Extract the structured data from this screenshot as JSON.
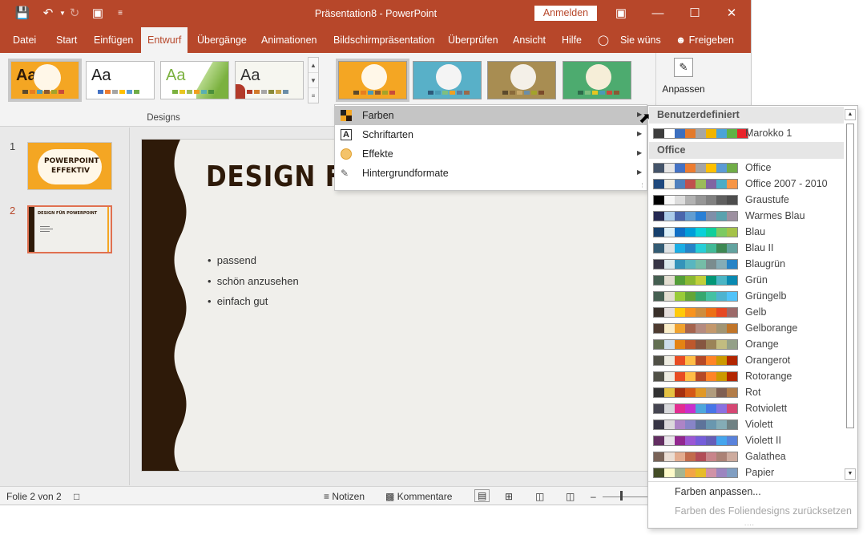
{
  "titlebar": {
    "title": "Präsentation8  -  PowerPoint",
    "signin": "Anmelden"
  },
  "tabs": [
    "Datei",
    "Start",
    "Einfügen",
    "Entwurf",
    "Übergänge",
    "Animationen",
    "Bildschirmpräsentation",
    "Überprüfen",
    "Ansicht",
    "Hilfe",
    "Sie wüns",
    "Freigeben"
  ],
  "ribbon": {
    "designs_label": "Designs",
    "themes": [
      {
        "label": "Aa",
        "bg": "#f4a623",
        "fg": "#2e1a09"
      },
      {
        "label": "Aa",
        "bg": "#ffffff",
        "fg": "#222222"
      },
      {
        "label": "Aa",
        "bg": "#ffffff",
        "fg": "#7bb13f"
      },
      {
        "label": "Aa",
        "bg": "#f6f6f0",
        "fg": "#333333"
      }
    ],
    "variants": [
      {
        "bg": "#f4a623",
        "circle": "#fff7e8"
      },
      {
        "bg": "#58b0c8",
        "circle": "#f4f4f4"
      },
      {
        "bg": "#a88d52",
        "circle": "#f4f0e8"
      },
      {
        "bg": "#4dab6f",
        "circle": "#f6eed8"
      }
    ],
    "customize_label": "Anpassen"
  },
  "slides_panel": {
    "slide1_num": "1",
    "slide1_text": "POWERPOINT EFFEKTIV",
    "slide2_num": "2",
    "slide2_title": "DESIGN FÜR POWERPOINT"
  },
  "slide": {
    "title": "DESIGN FÜ",
    "bullets": [
      "passend",
      "schön anzusehen",
      "einfach gut"
    ]
  },
  "statusbar": {
    "slide_info": "Folie 2 von 2",
    "notes": "Notizen",
    "comments": "Kommentare"
  },
  "menu": {
    "items": [
      {
        "label": "Farben",
        "icon": "colors-icon"
      },
      {
        "label": "Schriftarten",
        "icon": "fonts-icon"
      },
      {
        "label": "Effekte",
        "icon": "effects-icon"
      },
      {
        "label": "Hintergrundformate",
        "icon": "background-icon"
      }
    ]
  },
  "colors": {
    "custom_header": "Benutzerdefiniert",
    "office_header": "Office",
    "custom_link": "Farben anpassen...",
    "reset_link": "Farben des Foliendesigns zurücksetzen",
    "custom": [
      {
        "name": "Marokko 1",
        "swatches": [
          "#3d3d3d",
          "#ffffff",
          "#3c6fbf",
          "#e37a2c",
          "#a6a6a6",
          "#f0b400",
          "#4aa3d8",
          "#5fb246",
          "#e8242b"
        ]
      }
    ],
    "office": [
      {
        "name": "Office",
        "swatches": [
          "#44546a",
          "#e7e6e6",
          "#4472c4",
          "#ed7d31",
          "#a5a5a5",
          "#ffc000",
          "#5b9bd5",
          "#70ad47"
        ]
      },
      {
        "name": "Office 2007 - 2010",
        "swatches": [
          "#1f497d",
          "#eeece1",
          "#4f81bd",
          "#c0504d",
          "#9bbb59",
          "#8064a2",
          "#4bacc6",
          "#f79646"
        ]
      },
      {
        "name": "Graustufe",
        "swatches": [
          "#000000",
          "#f8f8f8",
          "#dddddd",
          "#b2b2b2",
          "#969696",
          "#808080",
          "#5f5f5f",
          "#4d4d4d"
        ]
      },
      {
        "name": "Warmes Blau",
        "swatches": [
          "#242852",
          "#acccea",
          "#4a66ac",
          "#629dd1",
          "#297fd5",
          "#7f8fa9",
          "#5aa2ae",
          "#9d90a0"
        ]
      },
      {
        "name": "Blau",
        "swatches": [
          "#17406d",
          "#dbeff9",
          "#0f6fc6",
          "#009dd9",
          "#0bd0d9",
          "#10cf9b",
          "#7cca62",
          "#a5c249"
        ]
      },
      {
        "name": "Blau II",
        "swatches": [
          "#335b74",
          "#dfe3e5",
          "#1cade4",
          "#2683c6",
          "#27ced7",
          "#42ba97",
          "#3e8853",
          "#62a39f"
        ]
      },
      {
        "name": "Blaugrün",
        "swatches": [
          "#373545",
          "#dceaec",
          "#3494ba",
          "#58b6c0",
          "#75bda7",
          "#7a8c8e",
          "#84acb6",
          "#2683c6"
        ]
      },
      {
        "name": "Grün",
        "swatches": [
          "#455f51",
          "#e3ded1",
          "#549e39",
          "#8ab833",
          "#c0cf3a",
          "#029676",
          "#4ab5c4",
          "#0989b1"
        ]
      },
      {
        "name": "Grüngelb",
        "swatches": [
          "#455f51",
          "#e3ded1",
          "#99cb38",
          "#63a537",
          "#37a76f",
          "#44c1a3",
          "#4eb3cf",
          "#51c3f9"
        ]
      },
      {
        "name": "Gelb",
        "swatches": [
          "#39302a",
          "#e5dedb",
          "#ffca08",
          "#f8931d",
          "#ce8d3e",
          "#ec7016",
          "#e64823",
          "#9c6a6a"
        ]
      },
      {
        "name": "Gelborange",
        "swatches": [
          "#4e3b30",
          "#fbeec9",
          "#f0a22e",
          "#a5644e",
          "#b58b80",
          "#c3986d",
          "#a19574",
          "#c17529"
        ]
      },
      {
        "name": "Orange",
        "swatches": [
          "#637052",
          "#ccddea",
          "#e48312",
          "#bd582c",
          "#865640",
          "#9b8357",
          "#c2bc80",
          "#94a088"
        ]
      },
      {
        "name": "Orangerot",
        "swatches": [
          "#505046",
          "#eeece1",
          "#e84c22",
          "#ffbd47",
          "#b64926",
          "#ff8427",
          "#cc9900",
          "#b22600"
        ]
      },
      {
        "name": "Rotorange",
        "swatches": [
          "#505046",
          "#eeece1",
          "#e84c22",
          "#ffbd47",
          "#b64926",
          "#ff8427",
          "#cc9900",
          "#b22600"
        ]
      },
      {
        "name": "Rot",
        "swatches": [
          "#323232",
          "#e5c243",
          "#a5300f",
          "#d55816",
          "#e19825",
          "#b19c7d",
          "#7f5f52",
          "#b27d49"
        ]
      },
      {
        "name": "Rotviolett",
        "swatches": [
          "#454551",
          "#d8d9dc",
          "#e32d91",
          "#c830cc",
          "#4ea6dc",
          "#4775e7",
          "#8971e1",
          "#d54773"
        ]
      },
      {
        "name": "Violett",
        "swatches": [
          "#373545",
          "#dcd8dc",
          "#ad84c6",
          "#8784c7",
          "#5d739a",
          "#6997af",
          "#84acb6",
          "#6f8183"
        ]
      },
      {
        "name": "Violett II",
        "swatches": [
          "#632e62",
          "#eae5eb",
          "#92278f",
          "#9b57d3",
          "#755dd9",
          "#665eb8",
          "#45a5ed",
          "#5982db"
        ]
      },
      {
        "name": "Galathea",
        "swatches": [
          "#796357",
          "#ebded4",
          "#e3ac8f",
          "#c26b4c",
          "#b24c57",
          "#c8848a",
          "#ab8276",
          "#cdab9e"
        ]
      },
      {
        "name": "Papier",
        "swatches": [
          "#444d26",
          "#fefac9",
          "#a5b592",
          "#f3a447",
          "#e7bc29",
          "#d092a7",
          "#9c85c0",
          "#809ec2"
        ]
      }
    ]
  },
  "accent": "#b7472a"
}
